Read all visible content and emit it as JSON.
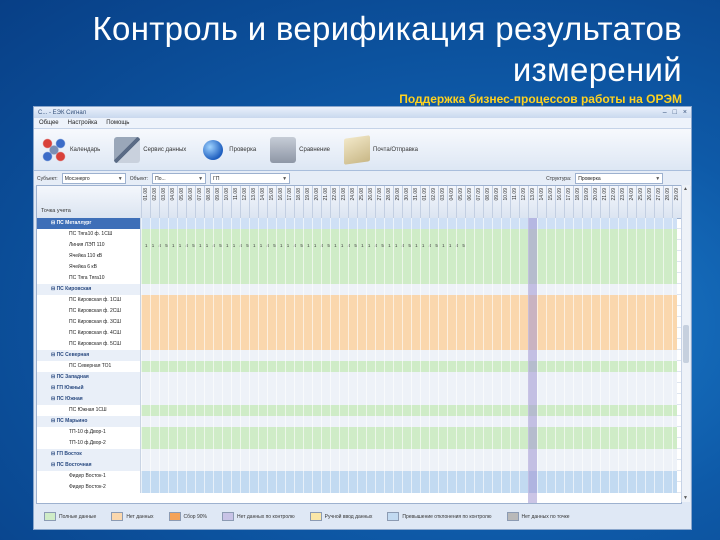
{
  "slide": {
    "title": "Контроль и верификация результатов измерений",
    "subtitle": "Поддержка бизнес-процессов работы на ОРЭМ"
  },
  "app": {
    "window_title": "С... - ЕЭК Сигнал",
    "menu": [
      "Общее",
      "Настройка",
      "Помощь"
    ],
    "ribbon": [
      {
        "label": "Календарь",
        "icon": "grid-icon"
      },
      {
        "label": "Сервис данных",
        "icon": "tools-icon"
      },
      {
        "label": "Проверка",
        "icon": "globe-icon"
      },
      {
        "label": "Сравнение",
        "icon": "fax-icon"
      },
      {
        "label": "Почта/Отправка",
        "icon": "mail-icon"
      }
    ],
    "filters": {
      "subject_label": "Субъект:",
      "subject_value": "Мосэнерго",
      "object_label": "Объект:",
      "object_value": "По...",
      "period_value": "ГП",
      "right_label": "Структура:",
      "right_value": "Проверка"
    },
    "grid": {
      "name_header": "Точка учета",
      "date_columns": [
        "01.08",
        "02.08",
        "03.08",
        "04.08",
        "05.08",
        "06.08",
        "07.08",
        "08.08",
        "09.08",
        "10.08",
        "11.08",
        "12.08",
        "13.08",
        "14.08",
        "15.08",
        "16.08",
        "17.08",
        "18.08",
        "19.08",
        "20.08",
        "21.08",
        "22.08",
        "23.08",
        "24.08",
        "25.08",
        "26.08",
        "27.08",
        "28.08",
        "29.08",
        "30.08",
        "31.08",
        "01.09",
        "02.09",
        "03.09",
        "04.09",
        "05.09",
        "06.09",
        "07.09",
        "08.09",
        "09.09",
        "10.09",
        "11.09",
        "12.09",
        "13.09",
        "14.09",
        "15.09",
        "16.09",
        "17.09",
        "18.09",
        "19.09",
        "20.09",
        "21.09",
        "22.09",
        "23.09",
        "24.09",
        "25.09",
        "26.09",
        "27.09",
        "28.09",
        "29.09"
      ],
      "rows": [
        {
          "name": "ПС Металлург",
          "type": "group",
          "color": "group",
          "selected": true
        },
        {
          "name": "ПС Тяга10 ф. 1СШ",
          "type": "item",
          "color": "green"
        },
        {
          "name": "Линия ЛЭП 110",
          "type": "item",
          "color": "green",
          "values": true
        },
        {
          "name": "Ячейка 110 кВ",
          "type": "item",
          "color": "green"
        },
        {
          "name": "Ячейка 6 кВ",
          "type": "item",
          "color": "green"
        },
        {
          "name": "ПС Тяга Тяга10",
          "type": "item",
          "color": "green"
        },
        {
          "name": "ПС Кировская",
          "type": "group",
          "color": "group"
        },
        {
          "name": "ПС Кировская ф. 1СШ",
          "type": "item",
          "color": "orange"
        },
        {
          "name": "ПС Кировская ф. 2СШ",
          "type": "item",
          "color": "orange"
        },
        {
          "name": "ПС Кировская ф. 3СШ",
          "type": "item",
          "color": "orange"
        },
        {
          "name": "ПС Кировская ф. 4СШ",
          "type": "item",
          "color": "orange"
        },
        {
          "name": "ПС Кировская ф. 5СШ",
          "type": "item",
          "color": "orange"
        },
        {
          "name": "ПС Северная",
          "type": "group",
          "color": "group"
        },
        {
          "name": "ПС Северная ТО1",
          "type": "item",
          "color": "green"
        },
        {
          "name": "ПС Западная",
          "type": "group",
          "color": "group"
        },
        {
          "name": "ГП Южный",
          "type": "group",
          "color": "group"
        },
        {
          "name": "ПС Южная",
          "type": "group",
          "color": "group"
        },
        {
          "name": "ПС Южная 1СШ",
          "type": "item",
          "color": "green"
        },
        {
          "name": "ПС Марьино",
          "type": "group",
          "color": "group"
        },
        {
          "name": "ТП-10 ф.Двор-1",
          "type": "item",
          "color": "green"
        },
        {
          "name": "ТП-10 ф.Двор-2",
          "type": "item",
          "color": "green"
        },
        {
          "name": "ГП Восток",
          "type": "group",
          "color": "group"
        },
        {
          "name": "ПС Восточная",
          "type": "group",
          "color": "group"
        },
        {
          "name": "Фидер Восток-1",
          "type": "item",
          "color": "blue"
        },
        {
          "name": "Фидер Восток-2",
          "type": "item",
          "color": "blue"
        }
      ],
      "value_text": "1 1 4 5  1 1 4 5  1 1 4 5  1 1 4 5  1 1 4 5  1 1 4 5  1 1 4 5  1 1 4 5  1 1 4 5  1 1 4 5  1 1 4 5  1 1 4 5"
    },
    "legend": [
      {
        "label": "Полные данные",
        "color": "#cfecc7"
      },
      {
        "label": "Нет данных",
        "color": "#fad7ad"
      },
      {
        "label": "Сбор 90%",
        "color": "#f4a35a"
      },
      {
        "label": "Нет данных по контролю",
        "color": "#c8c3e6"
      },
      {
        "label": "Ручной ввод данных",
        "color": "#fbe7a8"
      },
      {
        "label": "Превышение отклонения по контролю",
        "color": "#c2daf1"
      },
      {
        "label": "Нет данных по точке",
        "color": "#b9b9b9"
      }
    ]
  }
}
